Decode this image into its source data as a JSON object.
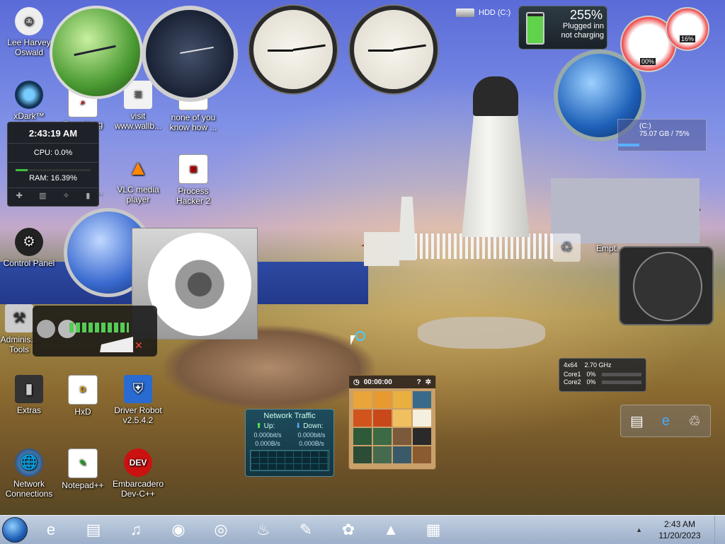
{
  "desktop_icons": [
    {
      "id": "lee",
      "label": "Lee Harvey\nOswald",
      "icon": "user-icon"
    },
    {
      "id": "xdark",
      "label": "xDark™",
      "icon": "xdark-icon"
    },
    {
      "id": "everything",
      "label": "Everything",
      "icon": "search-icon"
    },
    {
      "id": "visit",
      "label": "visit\nwww.wallb...",
      "icon": "document-icon"
    },
    {
      "id": "none",
      "label": "none of you\nknow how ...",
      "icon": "app-icon"
    },
    {
      "id": "write",
      "label": "write a h...",
      "icon": "app-icon"
    },
    {
      "id": "vlc",
      "label": "VLC media\nplayer",
      "icon": "vlc-icon"
    },
    {
      "id": "ph",
      "label": "Process\nHacker 2",
      "icon": "process-hacker-icon"
    },
    {
      "id": "cpanel",
      "label": "Control Panel",
      "icon": "control-panel-icon"
    },
    {
      "id": "admin",
      "label": "Adminis...\nTools",
      "icon": "admin-tools-icon"
    },
    {
      "id": "extras",
      "label": "Extras",
      "icon": "folder-icon"
    },
    {
      "id": "hxd",
      "label": "HxD",
      "icon": "hex-editor-icon"
    },
    {
      "id": "driver",
      "label": "Driver Robot\nv2.5.4.2",
      "icon": "driver-robot-icon"
    },
    {
      "id": "netconn",
      "label": "Network\nConnections",
      "icon": "network-icon"
    },
    {
      "id": "notepad",
      "label": "Notepad++",
      "icon": "notepad-icon"
    },
    {
      "id": "devcpp",
      "label": "Embarcadero\nDev-C++",
      "icon": "devcpp-icon"
    },
    {
      "id": "recycle",
      "label": "Empt...",
      "icon": "recycle-bin-icon"
    }
  ],
  "sysmon": {
    "time": "2:43:19 AM",
    "cpu": "CPU: 0.0%",
    "ram": "RAM: 16.39%",
    "ram_fraction": 0.1639
  },
  "battery": {
    "percent": "255%",
    "status_line1": "Plugged inn",
    "status_line2": "not charging"
  },
  "hdd": {
    "label": "HDD (C:)"
  },
  "cdrive": {
    "label": "(C:)",
    "usage": "75.07 GB / 75%"
  },
  "gauges": {
    "left": "00%",
    "right": "16%"
  },
  "cpuinfo": {
    "arch": "4x64",
    "freq": "2.70 GHz",
    "core1_label": "Core1",
    "core1_val": "0%",
    "core2_label": "Core2",
    "core2_val": "0%"
  },
  "network": {
    "title": "Network Traffic",
    "up_label": "Up:",
    "down_label": "Down:",
    "up_bits": "0.000bit/s",
    "down_bits": "0.000bit/s",
    "up_bytes": "0.000B/s",
    "down_bytes": "0.000B/s"
  },
  "puzzle": {
    "timer": "00:00:00"
  },
  "taskbar": {
    "apps": [
      {
        "id": "ie",
        "icon": "internet-explorer-icon",
        "glyph": "e"
      },
      {
        "id": "store",
        "icon": "store-icon",
        "glyph": "▤"
      },
      {
        "id": "music",
        "icon": "music-icon",
        "glyph": "♫"
      },
      {
        "id": "firefox",
        "icon": "firefox-icon",
        "glyph": "◉"
      },
      {
        "id": "chrome",
        "icon": "chrome-icon",
        "glyph": "◎"
      },
      {
        "id": "java",
        "icon": "java-icon",
        "glyph": "♨"
      },
      {
        "id": "tool",
        "icon": "tool-icon",
        "glyph": "✎"
      },
      {
        "id": "paint",
        "icon": "paint-icon",
        "glyph": "✿"
      },
      {
        "id": "aimp",
        "icon": "aimp-icon",
        "glyph": "▲"
      },
      {
        "id": "npp",
        "icon": "notepad-plus-icon",
        "glyph": "▦"
      }
    ],
    "time": "2:43 AM",
    "date": "11/20/2023"
  }
}
